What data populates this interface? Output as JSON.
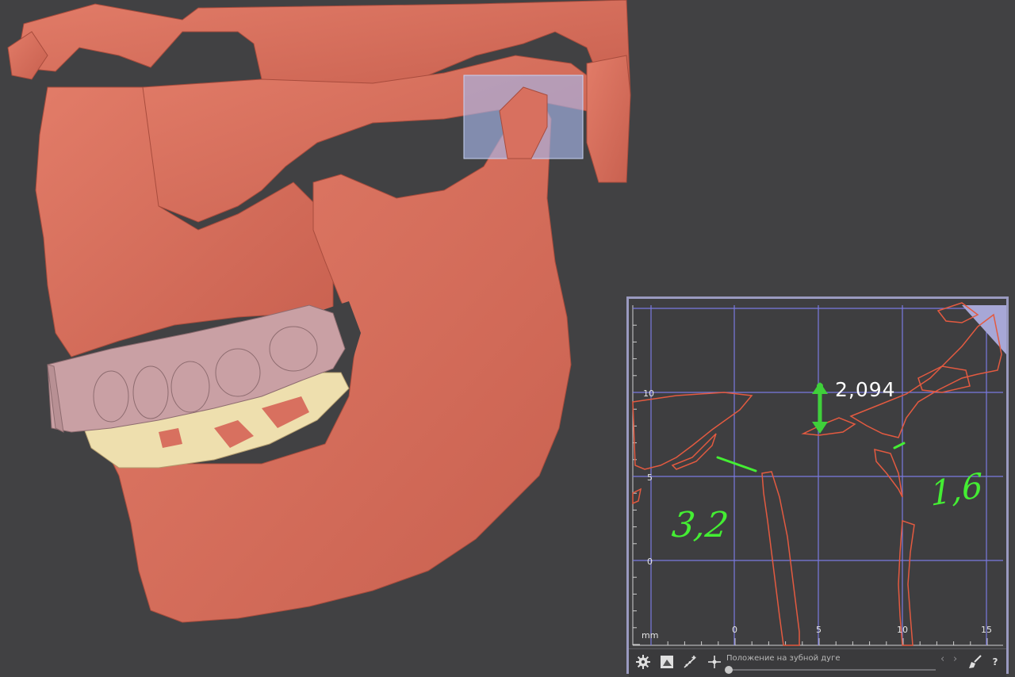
{
  "viewport": {
    "background": "#414143",
    "bone_color": "#d8705f",
    "upper_teeth_color": "#c9a0a4",
    "lower_teeth_color": "#eedfae",
    "section_plane_color": "#a6b6e8"
  },
  "section_panel": {
    "frame_color": "#9a9ac0",
    "grid_color": "#7a7ae0",
    "contour_color": "#e35a40",
    "measurement": {
      "value": "2,094",
      "color": "#3fd03a"
    },
    "handwritten_notes": [
      "3,2",
      "1,6"
    ],
    "axes": {
      "unit": "mm",
      "x_ticks": [
        "0",
        "5",
        "10",
        "15"
      ],
      "y_ticks": [
        "10",
        "5",
        "0"
      ]
    },
    "toolbar": {
      "slider_label": "Положение на зубной дуге",
      "slider_position": 0.0,
      "icons": [
        "gear-icon",
        "image-icon",
        "calibrate-icon",
        "move-icon",
        "brush-icon",
        "help-icon"
      ],
      "help_label": "?",
      "prev_label": "‹",
      "next_label": "›"
    }
  }
}
